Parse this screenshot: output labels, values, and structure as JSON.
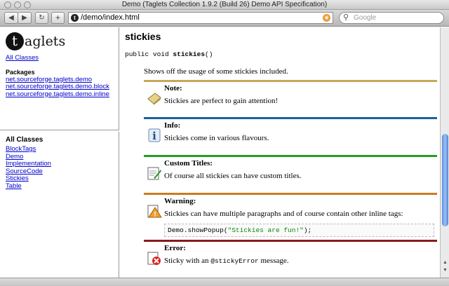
{
  "window": {
    "title": "Demo (Taglets Collection 1.9.2 (Build 26) Demo API Specification)"
  },
  "toolbar": {
    "back_icon": "back-arrow-icon",
    "forward_icon": "forward-arrow-icon",
    "back_glyph": "◀",
    "forward_glyph": "▶",
    "reload_glyph": "↻",
    "add_glyph": "+",
    "url": "/demo/index.html",
    "search_placeholder": "Google"
  },
  "left_top": {
    "logo_letter": "t",
    "logo_text": "aglets",
    "all_classes_link": "All Classes",
    "packages_heading": "Packages",
    "packages": [
      "net.sourceforge.taglets.demo",
      "net.sourceforge.taglets.demo.block",
      "net.sourceforge.taglets.demo.inline"
    ]
  },
  "left_bottom": {
    "heading": "All Classes",
    "classes": [
      "BlockTags",
      "Demo",
      "Implementation",
      "SourceCode",
      "Stickies",
      "Table"
    ]
  },
  "main": {
    "title": "stickies",
    "signature_prefix": "public void ",
    "signature_name": "stickies",
    "signature_suffix": "()",
    "description": "Shows off the usage of some stickies included.",
    "stickies": [
      {
        "title": "Note:",
        "body": "Stickies are perfect to gain attention!",
        "color": "#c7a857",
        "icon": "note-icon"
      },
      {
        "title": "Info:",
        "body": "Stickies come in various flavours.",
        "color": "#1f5f9c",
        "icon": "info-icon"
      },
      {
        "title": "Custom Titles:",
        "body": "Of course all stickies can have custom titles.",
        "color": "#22a022",
        "icon": "custom-title-icon"
      },
      {
        "title": "Warning:",
        "body": "Stickies can have multiple paragraphs and of course contain other inline tags:",
        "color": "#cc7a1f",
        "icon": "warning-icon",
        "code_object": "Demo",
        "code_method": ".showPopup(",
        "code_string": "\"Stickies are fun!\"",
        "code_end": ");"
      },
      {
        "title": "Error:",
        "body_prefix": "Sticky with an ",
        "body_code": "@stickyError",
        "body_suffix": " message.",
        "color": "#8b1a1a",
        "icon": "error-icon"
      }
    ]
  }
}
